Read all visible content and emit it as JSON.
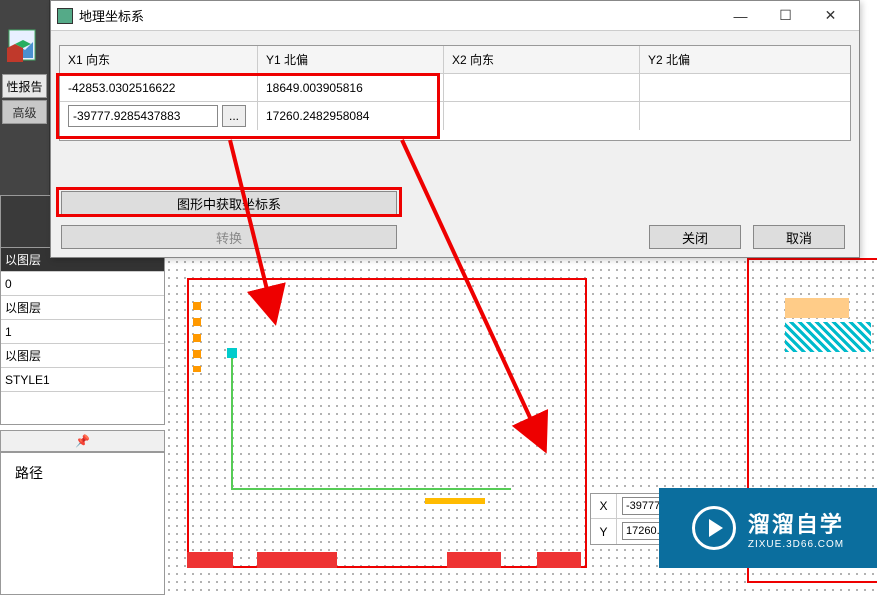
{
  "dialog": {
    "title": "地理坐标系",
    "columns": {
      "x1": "X1 向东",
      "y1": "Y1 北偏",
      "x2": "X2 向东",
      "y2": "Y2 北偏"
    },
    "rows": [
      {
        "x1": "-42853.0302516622",
        "y1": "18649.003905816",
        "x2": "",
        "y2": ""
      },
      {
        "x1": "-39777.9285437883",
        "y1": "17260.2482958084",
        "x2": "",
        "y2": ""
      }
    ],
    "cell_more_btn": "...",
    "buttons": {
      "get_coords": "图形中获取坐标系",
      "convert": "转换",
      "close": "关闭",
      "cancel": "取消"
    },
    "win": {
      "min": "—",
      "max": "☐",
      "close": "✕"
    }
  },
  "left_tabs": {
    "report": "性报告",
    "advanced": "高级"
  },
  "properties": {
    "rows": [
      {
        "label": "以图层",
        "dark": true
      },
      {
        "label": "0",
        "dark": false
      },
      {
        "label": "以图层",
        "dark": false
      },
      {
        "label": "1",
        "dark": false
      },
      {
        "label": "以图层",
        "dark": false
      },
      {
        "label": "STYLE1",
        "dark": false
      }
    ]
  },
  "pin_icon": "📌",
  "path_panel": {
    "label": "路径"
  },
  "coord_readout": {
    "x_label": "X",
    "y_label": "Y",
    "x_value": "-39777",
    "y_value": "17260."
  },
  "brand": {
    "name": "溜溜自学",
    "url": "ZIXUE.3D66.COM"
  },
  "annotation": {
    "color": "#e00000"
  }
}
